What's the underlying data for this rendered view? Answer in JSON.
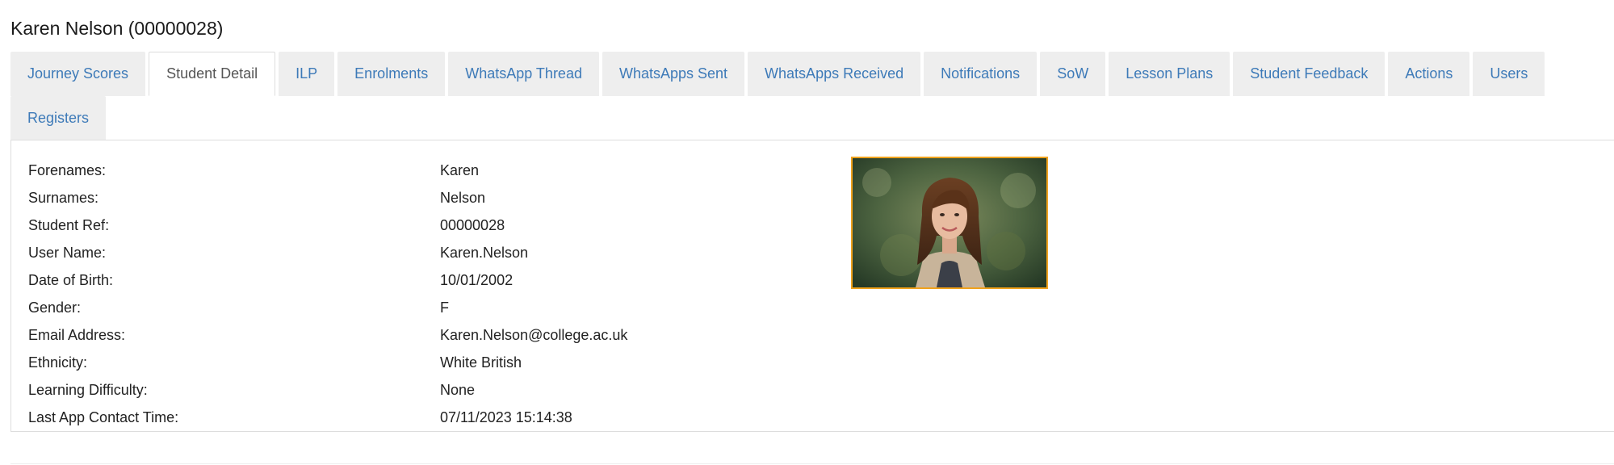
{
  "page": {
    "title": "Karen Nelson (00000028)"
  },
  "tabs": [
    {
      "label": "Journey Scores",
      "active": false
    },
    {
      "label": "Student Detail",
      "active": true
    },
    {
      "label": "ILP",
      "active": false
    },
    {
      "label": "Enrolments",
      "active": false
    },
    {
      "label": "WhatsApp Thread",
      "active": false
    },
    {
      "label": "WhatsApps Sent",
      "active": false
    },
    {
      "label": "WhatsApps Received",
      "active": false
    },
    {
      "label": "Notifications",
      "active": false
    },
    {
      "label": "SoW",
      "active": false
    },
    {
      "label": "Lesson Plans",
      "active": false
    },
    {
      "label": "Student Feedback",
      "active": false
    },
    {
      "label": "Actions",
      "active": false
    },
    {
      "label": "Users",
      "active": false
    },
    {
      "label": "Registers",
      "active": false
    }
  ],
  "student": {
    "fields": [
      {
        "label": "Forenames:",
        "value": "Karen"
      },
      {
        "label": "Surnames:",
        "value": "Nelson"
      },
      {
        "label": "Student Ref:",
        "value": "00000028"
      },
      {
        "label": "User Name:",
        "value": "Karen.Nelson"
      },
      {
        "label": "Date of Birth:",
        "value": "10/01/2002"
      },
      {
        "label": "Gender:",
        "value": "F"
      },
      {
        "label": "Email Address:",
        "value": "Karen.Nelson@college.ac.uk"
      },
      {
        "label": "Ethnicity:",
        "value": "White British"
      },
      {
        "label": "Learning Difficulty:",
        "value": "None"
      },
      {
        "label": "Last App Contact Time:",
        "value": "07/11/2023 15:14:38"
      }
    ]
  },
  "colors": {
    "link": "#3d7ab8",
    "active_tab_text": "#555555",
    "tab_background": "#eeeeee",
    "border": "#dddddd",
    "photo_border": "#f0a21c"
  }
}
